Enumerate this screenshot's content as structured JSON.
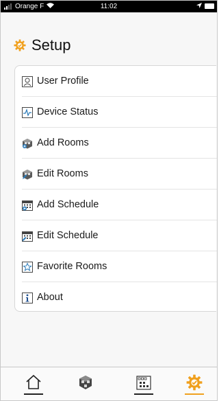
{
  "status_bar": {
    "carrier": "Orange F",
    "time": "11:02"
  },
  "header": {
    "title": "Setup",
    "icon": "gear-icon",
    "accent_color": "#f0a01e"
  },
  "menu": {
    "items": [
      {
        "label": "User Profile",
        "icon": "user-profile-icon"
      },
      {
        "label": "Device Status",
        "icon": "device-status-icon"
      },
      {
        "label": "Add Rooms",
        "icon": "add-rooms-icon"
      },
      {
        "label": "Edit Rooms",
        "icon": "edit-rooms-icon"
      },
      {
        "label": "Add Schedule",
        "icon": "add-schedule-icon"
      },
      {
        "label": "Edit Schedule",
        "icon": "edit-schedule-icon"
      },
      {
        "label": "Favorite Rooms",
        "icon": "favorite-rooms-icon"
      },
      {
        "label": "About",
        "icon": "about-icon"
      }
    ]
  },
  "tab_bar": {
    "tabs": [
      {
        "icon": "home-icon",
        "active": false
      },
      {
        "icon": "rooms-icon",
        "active": false
      },
      {
        "icon": "schedule-icon",
        "active": false
      },
      {
        "icon": "setup-gear-icon",
        "active": true
      }
    ]
  }
}
